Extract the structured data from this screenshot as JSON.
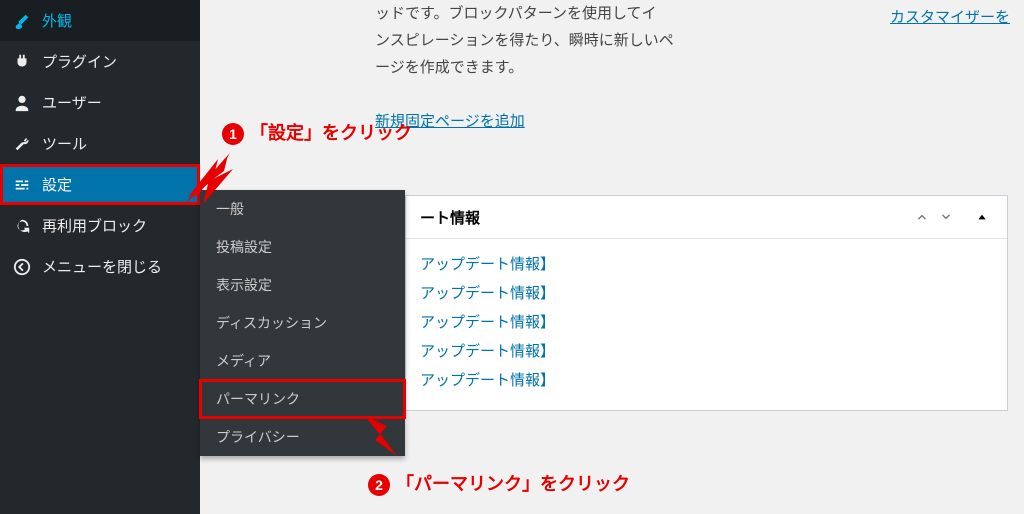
{
  "sidebar": {
    "items": [
      {
        "label": "外観",
        "icon": "appearance"
      },
      {
        "label": "プラグイン",
        "icon": "plugin"
      },
      {
        "label": "ユーザー",
        "icon": "user"
      },
      {
        "label": "ツール",
        "icon": "tool"
      },
      {
        "label": "設定",
        "icon": "settings",
        "selected": true
      },
      {
        "label": "再利用ブロック",
        "icon": "reuse"
      },
      {
        "label": "メニューを閉じる",
        "icon": "collapse"
      }
    ]
  },
  "submenu": {
    "items": [
      {
        "label": "一般"
      },
      {
        "label": "投稿設定"
      },
      {
        "label": "表示設定"
      },
      {
        "label": "ディスカッション"
      },
      {
        "label": "メディア"
      },
      {
        "label": "パーマリンク",
        "highlight": true
      },
      {
        "label": "プライバシー"
      }
    ]
  },
  "welcome": {
    "text_line1": "ッドです。ブロックパターンを使用してイ",
    "text_line2": "ンスピレーションを得たり、瞬時に新しいペ",
    "text_line3": "ージを作成できます。",
    "link": "新規固定ページを追加"
  },
  "customizer_link": "カスタマイザーを",
  "panel": {
    "title": "ート情報",
    "links": [
      "アップデート情報】",
      "アップデート情報】",
      "アップデート情報】",
      "アップデート情報】",
      "アップデート情報】"
    ]
  },
  "annotations": {
    "step1": {
      "num": "1",
      "text": "「設定」をクリック"
    },
    "step2": {
      "num": "2",
      "text": "「パーマリンク」をクリック"
    }
  }
}
